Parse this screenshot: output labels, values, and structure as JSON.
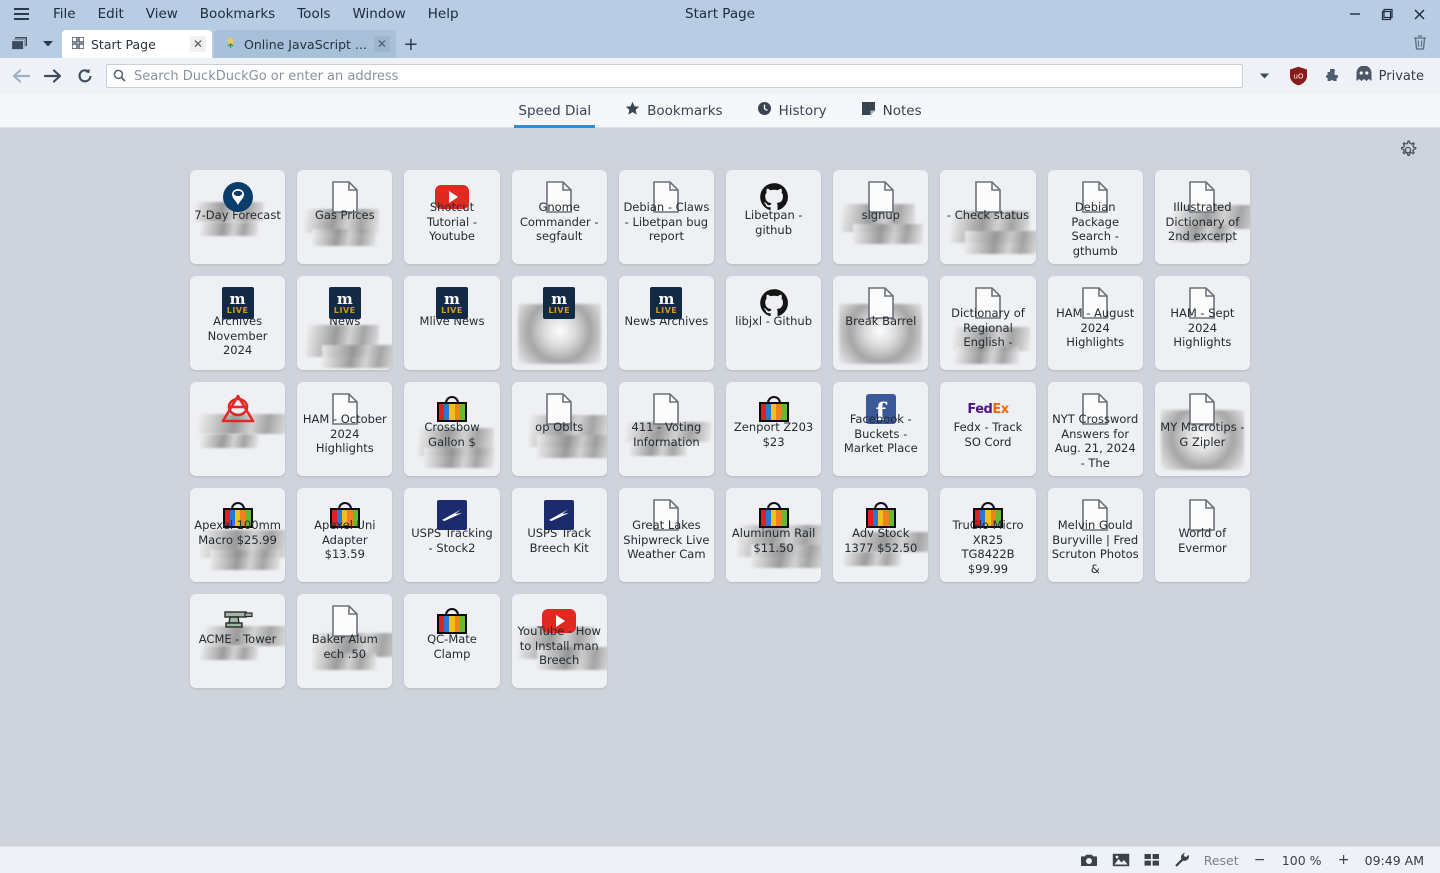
{
  "window": {
    "title": "Start Page",
    "menu": [
      "File",
      "Edit",
      "View",
      "Bookmarks",
      "Tools",
      "Window",
      "Help"
    ],
    "hamburger_icon": "hamburger-menu-icon",
    "controls": {
      "minimize": "—",
      "maximize": "❐",
      "close": "✕"
    }
  },
  "tabbar": {
    "tab_list_icon": "tab-stack-icon",
    "tab_menu_icon": "chevron-down-icon",
    "tabs": [
      {
        "label": "Start Page",
        "icon": "grid-icon",
        "close": "✕",
        "active": true
      },
      {
        "label": "Online JavaScript ...",
        "icon": "page-favicon",
        "close": "✕",
        "active": false
      }
    ],
    "new_tab": "+",
    "trash_icon": "trash-icon"
  },
  "addressbar": {
    "back_icon": "back-arrow-icon",
    "forward_icon": "forward-arrow-icon",
    "reload_icon": "reload-icon",
    "search_icon": "search-icon",
    "placeholder": "Search DuckDuckGo or enter an address",
    "value": "",
    "dropdown_icon": "chevron-down-icon",
    "shield_icon": "ublock-shield-icon",
    "extensions_icon": "puzzle-piece-icon",
    "private_label": "Private",
    "private_icon": "ghost-icon"
  },
  "speeddial_nav": {
    "items": [
      {
        "label": "Speed Dial",
        "icon": "",
        "active": true
      },
      {
        "label": "Bookmarks",
        "icon": "star-icon",
        "active": false
      },
      {
        "label": "History",
        "icon": "clock-icon",
        "active": false
      },
      {
        "label": "Notes",
        "icon": "note-icon",
        "active": false
      }
    ]
  },
  "board": {
    "settings_icon": "gear-icon",
    "tiles": [
      {
        "label": "7-Day Forecast",
        "icon": "noaa-icon",
        "thumb": "blur"
      },
      {
        "label": "Gas Prices",
        "icon": "document-icon",
        "thumb": "blur"
      },
      {
        "label": "Shotcut Tutorial - Youtube",
        "icon": "youtube-icon",
        "thumb": "none"
      },
      {
        "label": "Gnome Commander - segfault",
        "icon": "document-icon",
        "thumb": "none"
      },
      {
        "label": "Debian - Claws - Libetpan bug report",
        "icon": "document-icon",
        "thumb": "none"
      },
      {
        "label": "Libetpan - github",
        "icon": "github-icon",
        "thumb": "none"
      },
      {
        "label": "signup",
        "icon": "document-icon",
        "thumb": "blur"
      },
      {
        "label": "- Check status",
        "icon": "document-icon",
        "thumb": "blur"
      },
      {
        "label": "Debian Package Search - gthumb",
        "icon": "document-icon",
        "thumb": "none"
      },
      {
        "label": "Illustrated Dictionary of 2nd excerpt",
        "icon": "document-icon",
        "thumb": "blur"
      },
      {
        "label": "Archives November 2024",
        "icon": "mlive-icon",
        "thumb": "none"
      },
      {
        "label": "News",
        "icon": "mlive-icon",
        "thumb": "blur"
      },
      {
        "label": "Mlive News",
        "icon": "mlive-icon",
        "thumb": "none"
      },
      {
        "label": "",
        "icon": "mlive-icon",
        "thumb": "radial"
      },
      {
        "label": "News Archives",
        "icon": "mlive-icon",
        "thumb": "none"
      },
      {
        "label": "libjxl - Github",
        "icon": "github-icon",
        "thumb": "none"
      },
      {
        "label": "Break Barrel",
        "icon": "document-icon",
        "thumb": "radial"
      },
      {
        "label": "Dictionary of Regional English -",
        "icon": "document-icon",
        "thumb": "blur"
      },
      {
        "label": "HAM - August 2024 Highlights",
        "icon": "document-icon",
        "thumb": "none"
      },
      {
        "label": "HAM - Sept 2024 Highlights",
        "icon": "document-icon",
        "thumb": "none"
      },
      {
        "label": "",
        "icon": "nosign-icon",
        "thumb": "blur"
      },
      {
        "label": "HAM - October 2024 Highlights",
        "icon": "document-icon",
        "thumb": "none"
      },
      {
        "label": "Crossbow Gallon $",
        "icon": "shopping-bag-icon",
        "thumb": "blur"
      },
      {
        "label": "op Obits",
        "icon": "document-icon",
        "thumb": "blur"
      },
      {
        "label": "411 - Voting Information",
        "icon": "document-icon",
        "thumb": "blur"
      },
      {
        "label": "Zenport Z203 $23",
        "icon": "shopping-bag-icon",
        "thumb": "none"
      },
      {
        "label": "Facebook - Buckets - Market Place",
        "icon": "facebook-icon",
        "thumb": "none"
      },
      {
        "label": "Fedx - Track SO Cord",
        "icon": "fedex-icon",
        "thumb": "none"
      },
      {
        "label": "NYT Crossword Answers for Aug. 21, 2024 - The",
        "icon": "document-icon",
        "thumb": "none"
      },
      {
        "label": "MY Macrotips - G Zipler",
        "icon": "document-icon",
        "thumb": "radial"
      },
      {
        "label": "Apexel 100mm Macro $25.99",
        "icon": "shopping-bag-icon",
        "thumb": "blur"
      },
      {
        "label": "Apexel Uni Adapter $13.59",
        "icon": "shopping-bag-icon",
        "thumb": "none"
      },
      {
        "label": "USPS Tracking - Stock2",
        "icon": "usps-icon",
        "thumb": "none"
      },
      {
        "label": "USPS Track Breech Kit",
        "icon": "usps-icon",
        "thumb": "none"
      },
      {
        "label": "Great Lakes Shipwreck Live Weather Cam",
        "icon": "document-icon",
        "thumb": "none"
      },
      {
        "label": "Aluminum Rail $11.50",
        "icon": "shopping-bag-icon",
        "thumb": "blur"
      },
      {
        "label": "Adv Stock 1377 $52.50",
        "icon": "shopping-bag-icon",
        "thumb": "blur"
      },
      {
        "label": "TruGlo Micro XR25 TG8422B $99.99",
        "icon": "shopping-bag-icon",
        "thumb": "none"
      },
      {
        "label": "Melvin Gould Buryville | Fred Scruton Photos &",
        "icon": "document-icon",
        "thumb": "none"
      },
      {
        "label": "World of Evermor",
        "icon": "document-icon",
        "thumb": "none"
      },
      {
        "label": "ACME - Tower",
        "icon": "anvil-icon",
        "thumb": "blur"
      },
      {
        "label": "Baker Alum ech .50",
        "icon": "document-icon",
        "thumb": "blur"
      },
      {
        "label": "QC-Mate Clamp",
        "icon": "shopping-bag-icon",
        "thumb": "none"
      },
      {
        "label": "YouTube - How to Install man Breech",
        "icon": "youtube-icon",
        "thumb": "blur"
      }
    ]
  },
  "statusbar": {
    "camera_icon": "camera-icon",
    "image_icon": "image-icon",
    "grid_icon": "grid-view-icon",
    "wrench_icon": "wrench-icon",
    "reset_label": "Reset",
    "zoom_out": "−",
    "zoom_level": "100 %",
    "zoom_in": "+",
    "clock": "09:49 AM"
  },
  "colors": {
    "titlebar": "#b8cce4",
    "board_bg": "#cfd4dc",
    "tile_bg": "#eef0f4",
    "accent": "#2f8ed6"
  }
}
